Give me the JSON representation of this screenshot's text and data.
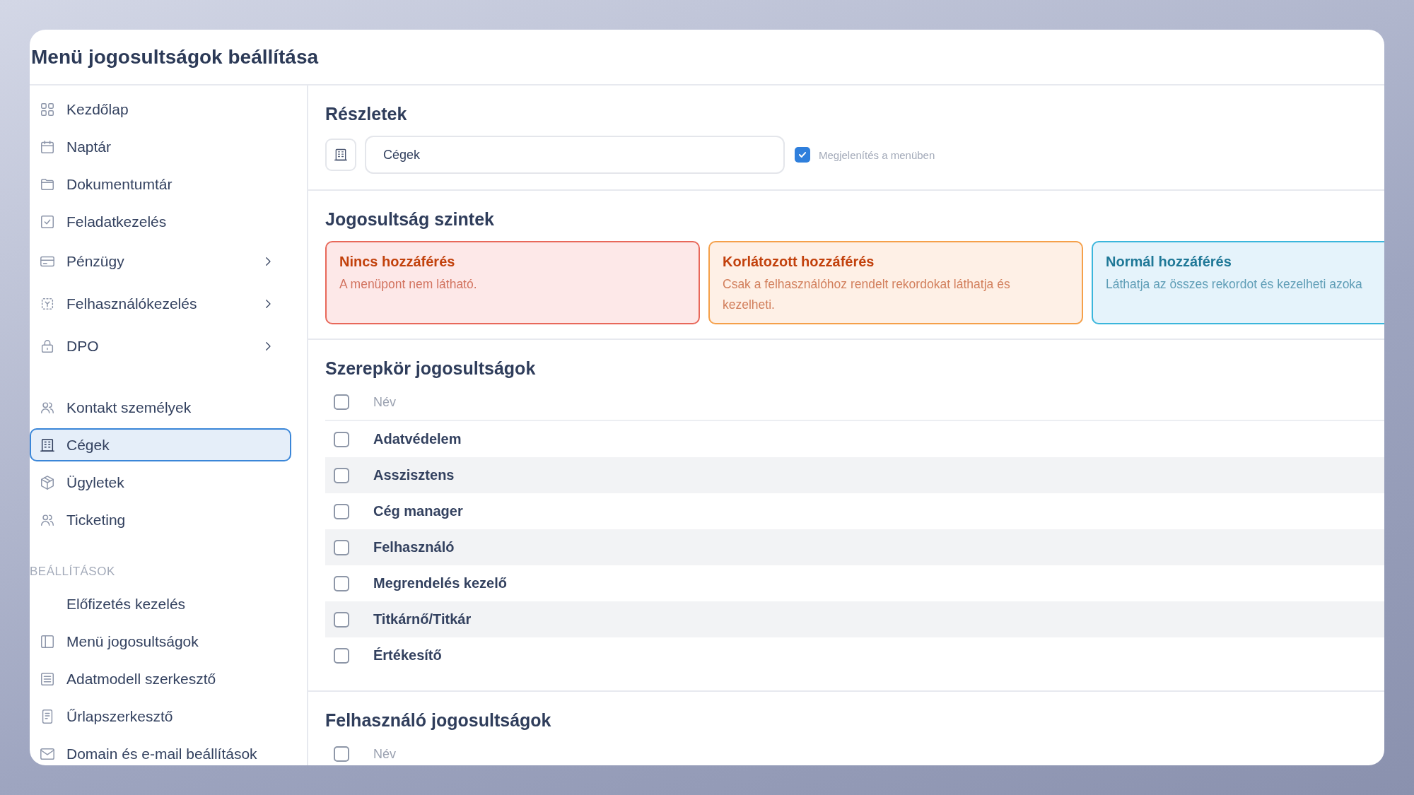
{
  "window": {
    "title": "Menü jogosultságok beállítása"
  },
  "sidebar": {
    "groups": [
      {
        "items": [
          {
            "label": "Kezdőlap",
            "selected": false,
            "submenu": false
          },
          {
            "label": "Naptár",
            "selected": false,
            "submenu": false
          },
          {
            "label": "Dokumentumtár",
            "selected": false,
            "submenu": false
          },
          {
            "label": "Feladatkezelés",
            "selected": false,
            "submenu": false
          },
          {
            "label": "Pénzügy",
            "selected": false,
            "submenu": true
          },
          {
            "label": "Felhasználókezelés",
            "selected": false,
            "submenu": true
          },
          {
            "label": "DPO",
            "selected": false,
            "submenu": true
          }
        ]
      },
      {
        "items": [
          {
            "label": "Kontakt személyek",
            "selected": false,
            "submenu": false
          },
          {
            "label": "Cégek",
            "selected": true,
            "submenu": false
          },
          {
            "label": "Ügyletek",
            "selected": false,
            "submenu": false
          },
          {
            "label": "Ticketing",
            "selected": false,
            "submenu": false
          }
        ]
      },
      {
        "heading": "BEÁLLÍTÁSOK",
        "items": [
          {
            "label": "Előfizetés kezelés",
            "selected": false,
            "submenu": false
          },
          {
            "label": "Menü jogosultságok",
            "selected": false,
            "submenu": false
          },
          {
            "label": "Adatmodell szerkesztő",
            "selected": false,
            "submenu": false
          },
          {
            "label": "Űrlapszerkesztő",
            "selected": false,
            "submenu": false
          },
          {
            "label": "Domain és e-mail beállítások",
            "selected": false,
            "submenu": false
          }
        ]
      }
    ]
  },
  "details": {
    "heading": "Részletek",
    "name_field": {
      "value": "Cégek"
    },
    "show_in_menu": {
      "label": "Megjelenítés a menüben",
      "checked": true
    }
  },
  "levels": {
    "heading": "Jogosultság szintek",
    "cards": [
      {
        "kind": "none",
        "title": "Nincs hozzáférés",
        "description": "A menüpont nem látható."
      },
      {
        "kind": "limited",
        "title": "Korlátozott hozzáférés",
        "description": "Csak a felhasználóhoz rendelt rekordokat láthatja és kezelheti."
      },
      {
        "kind": "normal",
        "title": "Normál hozzáférés",
        "description": "Láthatja az összes rekordot és kezelheti azoka"
      }
    ]
  },
  "roles": {
    "heading": "Szerepkör jogosultságok",
    "header": {
      "label": "Név",
      "checked": false
    },
    "rows": [
      {
        "name": "Adatvédelem",
        "checked": false
      },
      {
        "name": "Asszisztens",
        "checked": false
      },
      {
        "name": "Cég manager",
        "checked": false
      },
      {
        "name": "Felhasználó",
        "checked": false
      },
      {
        "name": "Megrendelés kezelő",
        "checked": false
      },
      {
        "name": "Titkárnő/Titkár",
        "checked": false
      },
      {
        "name": "Értékesítő",
        "checked": false
      }
    ]
  },
  "users": {
    "heading": "Felhasználó jogosultságok",
    "header": {
      "label": "Név",
      "checked": false
    }
  }
}
